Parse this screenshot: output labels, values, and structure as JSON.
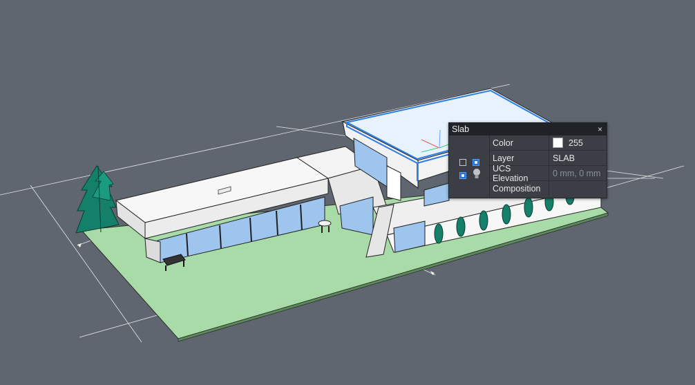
{
  "quad": {
    "title": "Slab",
    "close": "×",
    "properties": [
      {
        "label": "Color",
        "value": "255",
        "swatch": "#ffffff"
      },
      {
        "label": "Layer",
        "value": "SLAB"
      },
      {
        "label": "UCS Elevation",
        "value": "0 mm, 0 mm"
      },
      {
        "label": "Composition",
        "value": ""
      }
    ]
  },
  "colors": {
    "background": "#5f6670",
    "ground": "#a8dba8",
    "glass": "#9ec5ee",
    "selection": "#2f7fe0",
    "tree": "#14806a"
  }
}
